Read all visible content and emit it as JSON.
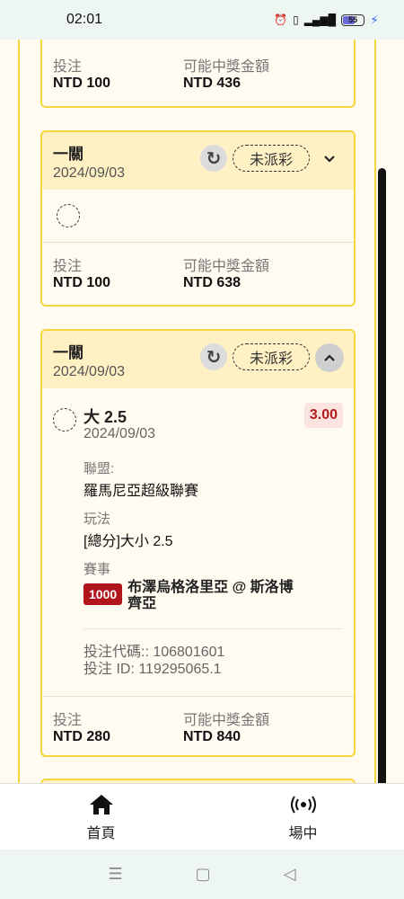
{
  "status_bar": {
    "time": "02:01",
    "battery": "55"
  },
  "labels": {
    "stake": "投注",
    "potential": "可能中獎金額"
  },
  "card0": {
    "stake": "NTD 100",
    "potential": "NTD 436"
  },
  "card1": {
    "title": "一關",
    "date": "2024/09/03",
    "status": "未派彩",
    "stake": "NTD 100",
    "potential": "NTD 638"
  },
  "card2": {
    "title": "一關",
    "date": "2024/09/03",
    "status": "未派彩",
    "selection": {
      "name": "大 2.5",
      "date": "2024/09/03",
      "odds": "3.00"
    },
    "league_label": "聯盟:",
    "league": "羅馬尼亞超級聯賽",
    "market_label": "玩法",
    "market": "[總分]大小 2.5",
    "event_label": "賽事",
    "event_badge": "1000",
    "event": "布澤烏格洛里亞 @ 斯洛博齊亞",
    "bet_code": "投注代碼:: 106801601",
    "bet_id": "投注 ID: 119295065.1",
    "stake": "NTD 280",
    "potential": "NTD 840"
  },
  "nav": {
    "home": "首頁",
    "live": "場中"
  },
  "icons": [
    "refresh-icon",
    "chevron-down-icon",
    "chevron-up-icon",
    "home-icon",
    "live-broadcast-icon",
    "alarm-icon",
    "vibrate-icon",
    "signal-icon",
    "battery-icon"
  ],
  "colors": {
    "accent": "#f5d63c",
    "header": "#fff1c4",
    "odds": "#b21c1c",
    "badge": "#b2141e"
  }
}
